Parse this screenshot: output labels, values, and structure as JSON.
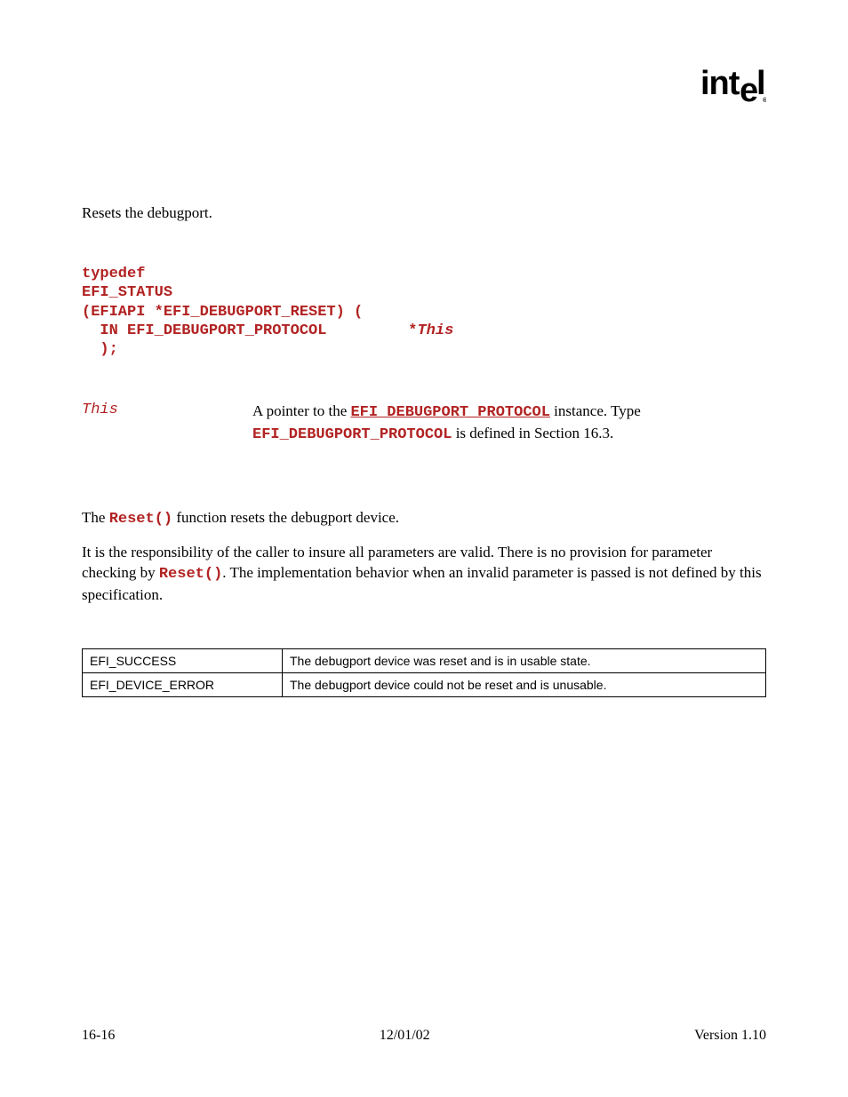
{
  "logo": "intel",
  "summary": "Resets the debugport.",
  "prototype": {
    "line1": "typedef",
    "line2": "EFI_STATUS",
    "line3": "(EFIAPI *EFI_DEBUGPORT_RESET) (",
    "line4a": "  IN EFI_DEBUGPORT_PROTOCOL         *",
    "line4b": "This",
    "line5": "  );"
  },
  "param": {
    "name": "This",
    "desc_pre": "A pointer to the ",
    "desc_code1": "EFI_DEBUGPORT_PROTOCOL",
    "desc_mid": " instance.  Type ",
    "desc_code2": "EFI_DEBUGPORT_PROTOCOL",
    "desc_post": " is defined in Section 16.3."
  },
  "description": {
    "p1_pre": "The ",
    "p1_code": "Reset()",
    "p1_post": " function resets the debugport device.",
    "p2_pre": "It is the responsibility of the caller to insure all parameters are valid.  There is no provision for parameter checking by ",
    "p2_code": "Reset()",
    "p2_post": ".  The implementation behavior when an invalid parameter is passed is not defined by this specification."
  },
  "status_table": [
    {
      "code": "EFI_SUCCESS",
      "desc": "The debugport device was reset and is in usable state."
    },
    {
      "code": "EFI_DEVICE_ERROR",
      "desc": "The debugport device could not be reset and is unusable."
    }
  ],
  "footer": {
    "left": "16-16",
    "center": "12/01/02",
    "right": "Version 1.10"
  }
}
